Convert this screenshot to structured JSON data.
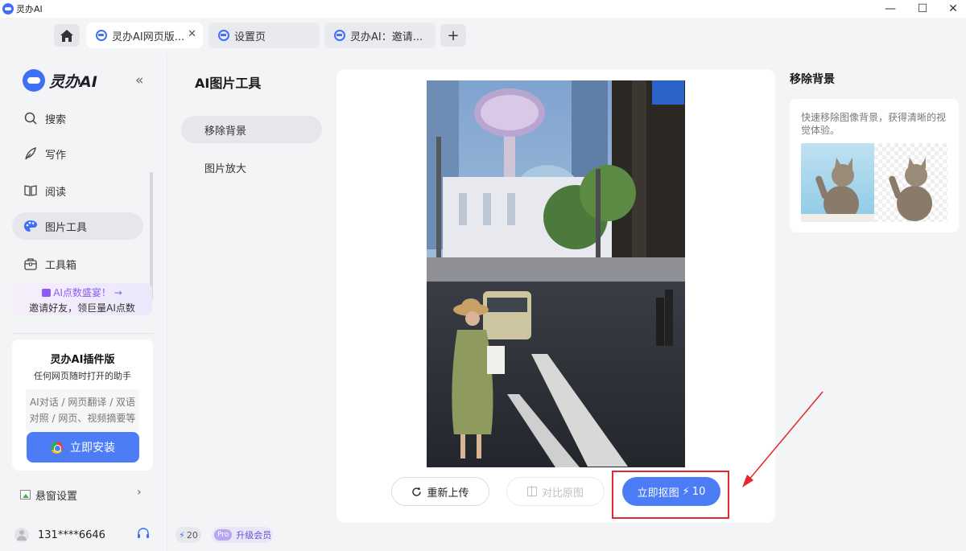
{
  "window": {
    "app_name": "灵办AI",
    "controls": [
      "—",
      "☐",
      "✕"
    ]
  },
  "tabs": [
    {
      "label": "灵办AI网页版...",
      "active": true,
      "closable": true
    },
    {
      "label": "设置页",
      "active": false,
      "closable": false
    },
    {
      "label": "灵办AI：邀请...",
      "active": false,
      "closable": false
    }
  ],
  "tabbar": {
    "new_tab": "+"
  },
  "sidebar": {
    "brand": "灵办AI",
    "collapse": "«",
    "items": [
      {
        "label": "搜索",
        "icon": "search-icon",
        "active": false
      },
      {
        "label": "写作",
        "icon": "pen-icon",
        "active": false
      },
      {
        "label": "阅读",
        "icon": "book-icon",
        "active": false
      },
      {
        "label": "图片工具",
        "icon": "palette-icon",
        "active": true
      },
      {
        "label": "工具箱",
        "icon": "toolbox-icon",
        "active": false
      }
    ],
    "promo": {
      "title": "AI点数盛宴！ →",
      "subtitle": "邀请好友，领巨量AI点数"
    },
    "plugin": {
      "title": "灵办AI插件版",
      "subtitle": "任何网页随时打开的助手",
      "features_line1": "AI对话 / 网页翻译 / 双语",
      "features_line2": "对照 / 网页、视频摘要等",
      "install_label": "立即安装"
    },
    "float_settings": "悬窗设置",
    "user_phone": "131****6646"
  },
  "tools_panel": {
    "title": "AI图片工具",
    "items": [
      {
        "label": "移除背景",
        "active": true
      },
      {
        "label": "图片放大",
        "active": false
      }
    ],
    "credits": "20",
    "upgrade_tag": "Pro",
    "upgrade_label": "升级会员"
  },
  "main": {
    "reupload_label": "重新上传",
    "compare_label": "对比原图",
    "cutout_label": "立即抠图",
    "cutout_cost": "10"
  },
  "info_panel": {
    "title": "移除背景",
    "description": "快速移除图像背景，获得清晰的视觉体验。"
  },
  "colors": {
    "accent": "#4d7cf7",
    "highlight": "#e5262e",
    "promo_text": "#8b5cf6"
  }
}
